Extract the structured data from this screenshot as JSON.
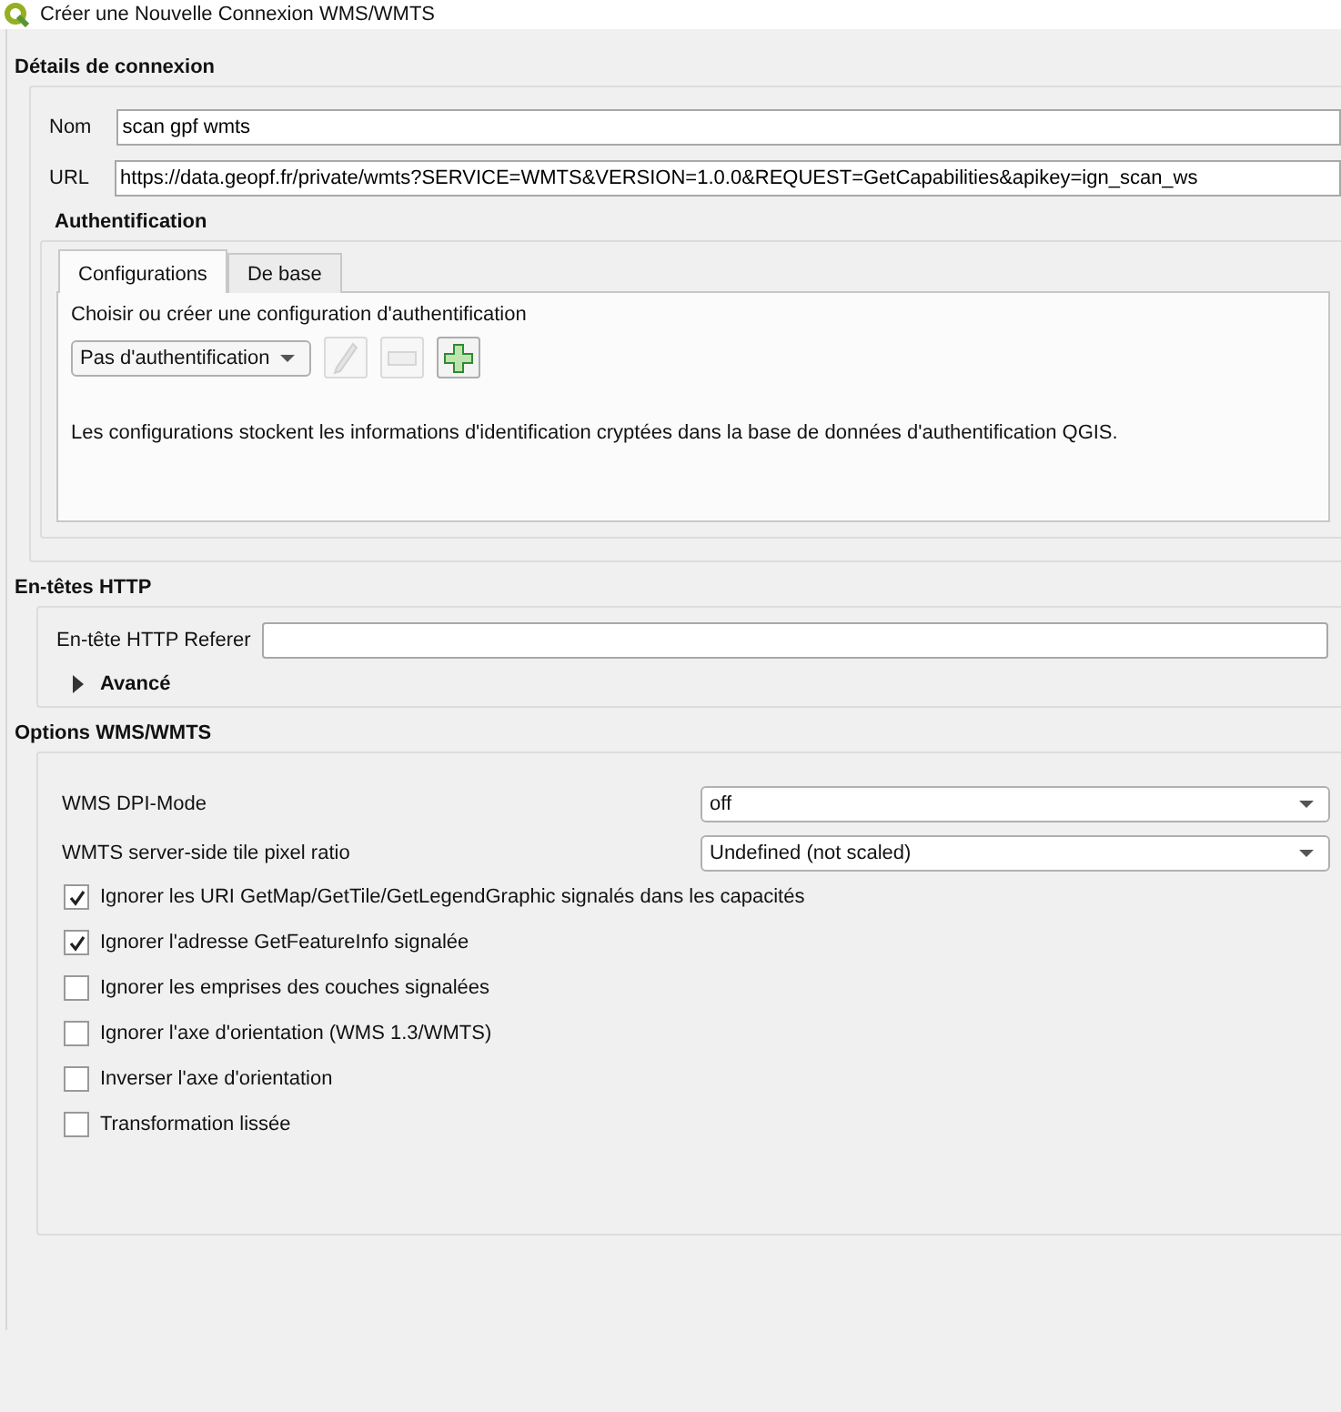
{
  "window": {
    "title": "Créer une Nouvelle Connexion WMS/WMTS"
  },
  "connection": {
    "title": "Détails de connexion",
    "fields": [
      {
        "label": "Nom",
        "value": "scan gpf wmts"
      },
      {
        "label": "URL",
        "value": "https://data.geopf.fr/private/wmts?SERVICE=WMTS&VERSION=1.0.0&REQUEST=GetCapabilities&apikey=ign_scan_ws"
      }
    ]
  },
  "auth": {
    "title": "Authentification",
    "tabs": [
      {
        "label": "Configurations",
        "selected": true
      },
      {
        "label": "De base",
        "selected": false
      }
    ],
    "prompt": "Choisir ou créer une configuration d'authentification",
    "dropdown": "Pas d'authentification",
    "buttons": [
      {
        "kind": "edit",
        "disabled": true
      },
      {
        "kind": "remove",
        "disabled": true
      },
      {
        "kind": "add",
        "disabled": false
      }
    ],
    "note": "Les configurations stockent les informations d'identification cryptées dans la base de données d'authentification QGIS."
  },
  "http": {
    "title": "En-têtes HTTP",
    "referer_label": "En-tête HTTP Referer",
    "advanced": {
      "label": "Avancé",
      "expanded": false
    }
  },
  "options": {
    "title": "Options WMS/WMTS",
    "selects": [
      {
        "label": "WMS DPI-Mode",
        "value": "off"
      },
      {
        "label": "WMTS server-side tile pixel ratio",
        "value": "Undefined (not scaled)"
      }
    ],
    "checkboxes": [
      {
        "label": "Ignorer les URI GetMap/GetTile/GetLegendGraphic signalés dans les capacités",
        "checked": true
      },
      {
        "label": "Ignorer l'adresse GetFeatureInfo signalée",
        "checked": true
      },
      {
        "label": "Ignorer les emprises des couches signalées",
        "checked": false
      },
      {
        "label": "Ignorer l'axe d'orientation (WMS 1.3/WMTS)",
        "checked": false
      },
      {
        "label": "Inverser l'axe d'orientation",
        "checked": false
      },
      {
        "label": "Transformation lissée",
        "checked": false
      }
    ]
  }
}
